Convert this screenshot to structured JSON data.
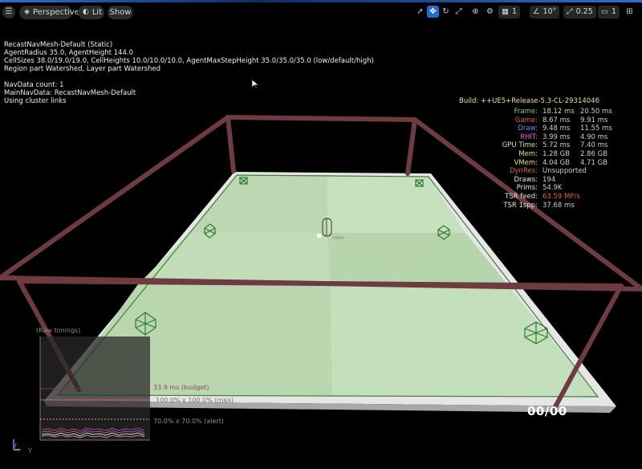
{
  "toolbar": {
    "menu_icon": "hamburger-icon",
    "perspective_label": "Perspective",
    "lit_label": "Lit",
    "show_label": "Show",
    "grid_value": "1",
    "angle_value": "10°",
    "scale_value": "0.25",
    "camera_speed_value": "1"
  },
  "navmesh_info": {
    "line1": "RecastNavMesh-Default (Static)",
    "line2": "AgentRadius 35.0, AgentHeight 144.0",
    "line3": "CellSizes 38.0/19.0/19.0, CellHeights 10.0/10.0/10.0, AgentMaxStepHeight 35.0/35.0/35.0 (low/default/high)",
    "line4": "Region part Watershed, Layer part Watershed",
    "line5": "NavData count: 1",
    "line6": "MainNavData: RecastNavMesh-Default",
    "line7": "Using cluster links"
  },
  "build": "Build: ++UE5+Release-5.3-CL-29314046",
  "stats": [
    {
      "label": "Frame:",
      "v1": "18.12 ms",
      "v2": "20.50 ms",
      "color": "#7cd57c"
    },
    {
      "label": "Game:",
      "v1": "8.67 ms",
      "v2": "9.91 ms",
      "color": "#e06060"
    },
    {
      "label": "Draw:",
      "v1": "9.48 ms",
      "v2": "11.55 ms",
      "color": "#6a8cff"
    },
    {
      "label": "RHIT:",
      "v1": "3.99 ms",
      "v2": "4.90 ms",
      "color": "#e070e0"
    },
    {
      "label": "GPU Time:",
      "v1": "5.72 ms",
      "v2": "7.40 ms",
      "color": "#e6e36a"
    },
    {
      "label": "Mem:",
      "v1": "1.28 GB",
      "v2": "2.86 GB",
      "color": "#e6e36a"
    },
    {
      "label": "VMem:",
      "v1": "4.04 GB",
      "v2": "4.71 GB",
      "color": "#e6e36a"
    },
    {
      "label": "DynRes:",
      "v1": "Unsupported",
      "v2": "",
      "color": "#e06060"
    },
    {
      "label": "Draws:",
      "v1": "194",
      "v2": "",
      "color": "#e6e6e6"
    },
    {
      "label": "Prims:",
      "v1": "54.9K",
      "v2": "",
      "color": "#e6e6e6"
    },
    {
      "label": "TSR feed:",
      "v1": "63.59 MP/s",
      "v2": "",
      "color": "#e6e6e6",
      "v1color": "#e06060"
    },
    {
      "label": "TSR 1spp:",
      "v1": "37.68 ms",
      "v2": "",
      "color": "#e6e6e6"
    }
  ],
  "graph": {
    "title": "(Raw timings)",
    "budget": "33.9 ms (budget)",
    "max": "100.0% x 100.0% (max)",
    "alert": "70.0% x 70.0% (alert)"
  },
  "counter": "00/00",
  "axis_label": "Y",
  "colors": {
    "floor": "#cfe3c8",
    "navmesh": "#8fc28a",
    "bounds": "#6e3b41",
    "accent": "#1f6fd1"
  }
}
